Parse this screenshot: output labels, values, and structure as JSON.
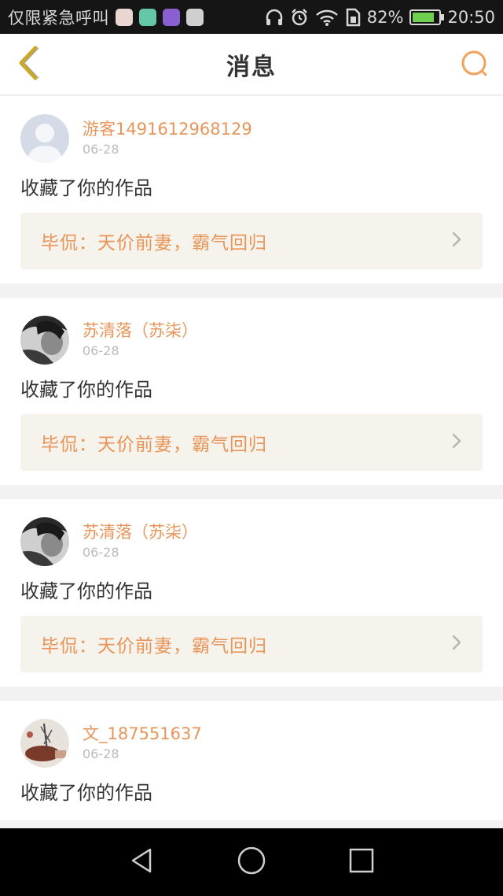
{
  "status_bar": {
    "carrier": "仅限紧急呼叫",
    "battery_percent": "82%",
    "battery_level": 0.82,
    "time": "20:50",
    "icons": [
      "notification-app-icon",
      "notification-app-icon",
      "notification-gallery-icon",
      "notification-app-icon",
      "headphones-icon",
      "alarm-icon",
      "wifi-icon",
      "sim-card-icon",
      "battery-icon"
    ]
  },
  "header": {
    "title": "消息",
    "back_icon": "back-chevron-icon",
    "search_icon": "search-icon"
  },
  "messages": [
    {
      "username": "游客1491612968129",
      "date": "06-28",
      "action": "收藏了你的作品",
      "work_title": "毕侃：天价前妻，霸气回归",
      "avatar": "default-avatar"
    },
    {
      "username": "苏清落（苏柒）",
      "date": "06-28",
      "action": "收藏了你的作品",
      "work_title": "毕侃：天价前妻，霸气回归",
      "avatar": "user-photo-avatar"
    },
    {
      "username": "苏清落（苏柒）",
      "date": "06-28",
      "action": "收藏了你的作品",
      "work_title": "毕侃：天价前妻，霸气回归",
      "avatar": "user-photo-avatar"
    },
    {
      "username": "文_187551637",
      "date": "06-28",
      "action": "收藏了你的作品",
      "work_title": "",
      "avatar": "user-photo-avatar"
    }
  ],
  "colors": {
    "accent": "#e8955a",
    "back_icon": "#c9a92c",
    "card_link_bg": "#f5f3ec"
  }
}
